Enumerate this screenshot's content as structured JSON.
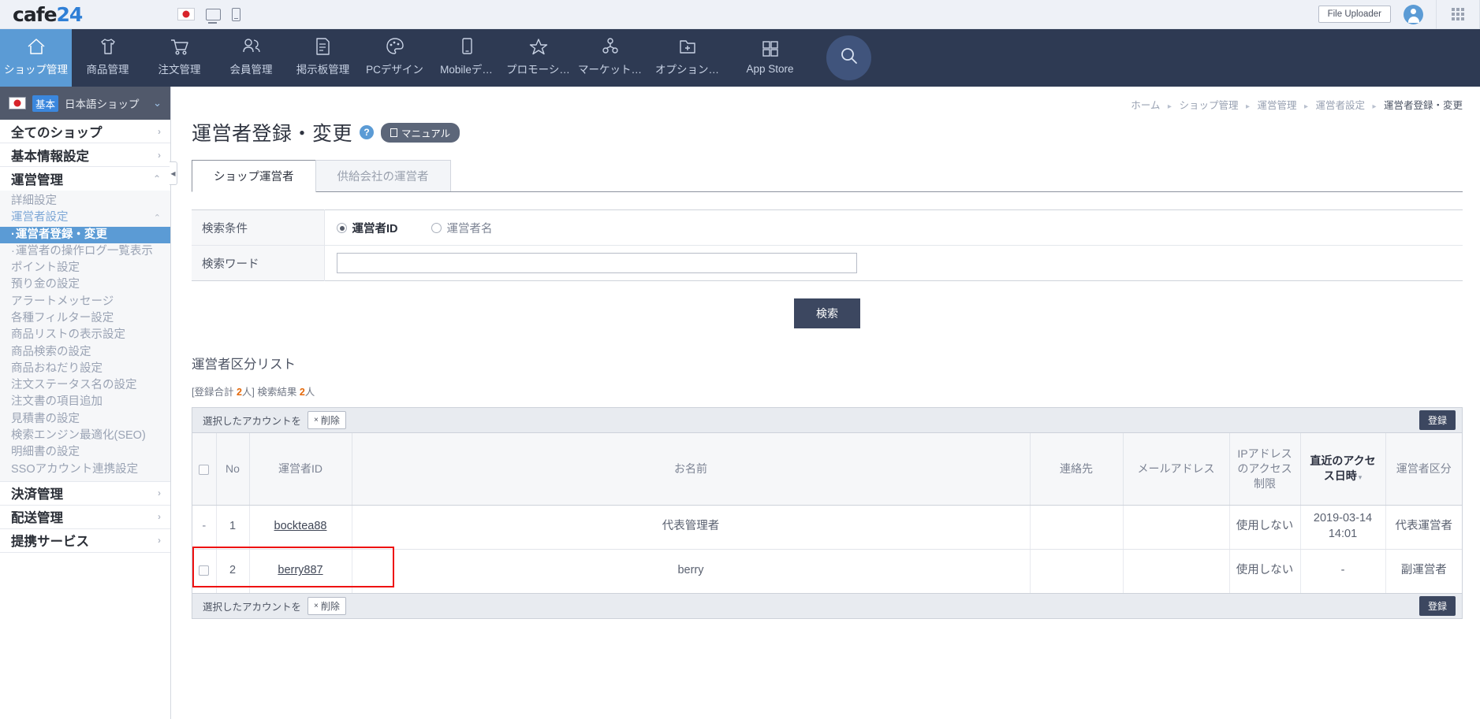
{
  "topbar": {
    "logo_text": "cafe",
    "logo_text_blue": "24",
    "icons": [
      "jp-flag-icon",
      "monitor-icon",
      "mobile-icon"
    ],
    "file_uploader_label": "File Uploader",
    "avatar_label": "user-avatar",
    "apps_label": "apps-grid"
  },
  "nav": {
    "items": [
      {
        "label": "ショップ管理",
        "icon": "home-icon",
        "active": true
      },
      {
        "label": "商品管理",
        "icon": "tshirt-icon",
        "active": false
      },
      {
        "label": "注文管理",
        "icon": "cart-icon",
        "active": false
      },
      {
        "label": "会員管理",
        "icon": "members-icon",
        "active": false
      },
      {
        "label": "掲示板管理",
        "icon": "board-icon",
        "active": false
      },
      {
        "label": "PCデザイン",
        "icon": "palette-icon",
        "active": false
      },
      {
        "label": "Mobileデ…",
        "icon": "mobile-icon",
        "active": false
      },
      {
        "label": "プロモーシ…",
        "icon": "star-icon",
        "active": false
      },
      {
        "label": "マーケット…",
        "icon": "network-icon",
        "active": false
      },
      {
        "label": "オプション…",
        "icon": "folder-plus-icon",
        "active": false
      },
      {
        "label": "App Store",
        "icon": "grid-icon",
        "active": false
      }
    ],
    "search_icon": "search-icon"
  },
  "sidebar": {
    "shop_selector": {
      "badge": "基本",
      "name": "日本語ショップ",
      "flag": "jp-flag-icon",
      "chevron": "⌄"
    },
    "groups": [
      {
        "label": "全てのショップ",
        "arrow": "›",
        "expanded": false
      },
      {
        "label": "基本情報設定",
        "arrow": "›",
        "expanded": false
      },
      {
        "label": "運営管理",
        "arrow": "⌃",
        "expanded": true
      }
    ],
    "items": [
      {
        "label": "詳細設定",
        "style": "plain"
      },
      {
        "label": "運営者設定",
        "style": "link",
        "arrow": "⌃"
      },
      {
        "label": "運営者登録・変更",
        "style": "selected",
        "dotted": true
      },
      {
        "label": "運営者の操作ログ一覧表示",
        "style": "plain",
        "dotted": true
      },
      {
        "label": "ポイント設定",
        "style": "plain"
      },
      {
        "label": "預り金の設定",
        "style": "plain"
      },
      {
        "label": "アラートメッセージ",
        "style": "plain"
      },
      {
        "label": "各種フィルター設定",
        "style": "plain"
      },
      {
        "label": "商品リストの表示設定",
        "style": "plain"
      },
      {
        "label": "商品検索の設定",
        "style": "plain"
      },
      {
        "label": "商品おねだり設定",
        "style": "plain"
      },
      {
        "label": "注文ステータス名の設定",
        "style": "plain"
      },
      {
        "label": "注文書の項目追加",
        "style": "plain"
      },
      {
        "label": "見積書の設定",
        "style": "plain"
      },
      {
        "label": "検索エンジン最適化(SEO)",
        "style": "plain"
      },
      {
        "label": "明細書の設定",
        "style": "plain"
      },
      {
        "label": "SSOアカウント連携設定",
        "style": "plain"
      }
    ],
    "groups_bottom": [
      {
        "label": "決済管理",
        "arrow": "›"
      },
      {
        "label": "配送管理",
        "arrow": "›"
      },
      {
        "label": "提携サービス",
        "arrow": "›"
      }
    ],
    "collapse_icon": "◀"
  },
  "breadcrumb": {
    "items": [
      "ホーム",
      "ショップ管理",
      "運営管理",
      "運営者設定",
      "運営者登録・変更"
    ],
    "separator": "▸"
  },
  "page": {
    "title": "運営者登録・変更",
    "help_icon": "?",
    "manual_label": "マニュアル"
  },
  "tabs": [
    {
      "label": "ショップ運営者",
      "active": true
    },
    {
      "label": "供給会社の運営者",
      "active": false
    }
  ],
  "search_form": {
    "condition_label": "検索条件",
    "options": [
      {
        "label": "運営者ID",
        "selected": true
      },
      {
        "label": "運営者名",
        "selected": false
      }
    ],
    "keyword_label": "検索ワード",
    "keyword_value": "",
    "keyword_placeholder": "",
    "submit_label": "検索"
  },
  "list": {
    "title": "運営者区分リスト",
    "count_prefix": "[登録合計 ",
    "count_total": "2",
    "count_mid": "人] 検索結果 ",
    "count_result": "2",
    "count_suffix": "人",
    "toolbar": {
      "selected_label": "選択したアカウントを",
      "delete_label": "削除",
      "delete_x": "×",
      "register_label": "登録"
    },
    "columns": [
      {
        "key": "chk",
        "label": "",
        "sortable": false
      },
      {
        "key": "no",
        "label": "No",
        "sortable": false
      },
      {
        "key": "id",
        "label": "運営者ID",
        "sortable": false
      },
      {
        "key": "name",
        "label": "お名前",
        "sortable": false
      },
      {
        "key": "tel",
        "label": "連絡先",
        "sortable": false
      },
      {
        "key": "mail",
        "label": "メールアドレス",
        "sortable": false
      },
      {
        "key": "ip",
        "label": "IPアドレスのアクセス制限",
        "sortable": false
      },
      {
        "key": "access",
        "label": "直近のアクセス日時",
        "sortable": true,
        "caret": "▾"
      },
      {
        "key": "div",
        "label": "運営者区分",
        "sortable": false
      }
    ],
    "rows": [
      {
        "chk": "-",
        "chk_type": "dash",
        "no": "1",
        "id": "bocktea88",
        "name": "代表管理者",
        "tel": "",
        "mail": "",
        "ip": "使用しない",
        "access": "2019-03-14 14:01",
        "div": "代表運営者",
        "highlighted": false
      },
      {
        "chk": "",
        "chk_type": "checkbox",
        "no": "2",
        "id": "berry887",
        "name": "berry",
        "tel": "",
        "mail": "",
        "ip": "使用しない",
        "access": "-",
        "div": "副運営者",
        "highlighted": true
      }
    ]
  },
  "colors": {
    "nav_bg": "#2e3a53",
    "accent_blue": "#5b9bd5",
    "dark_button": "#3c4760",
    "highlight_red": "#ee1111",
    "count_orange": "#e4690b"
  }
}
